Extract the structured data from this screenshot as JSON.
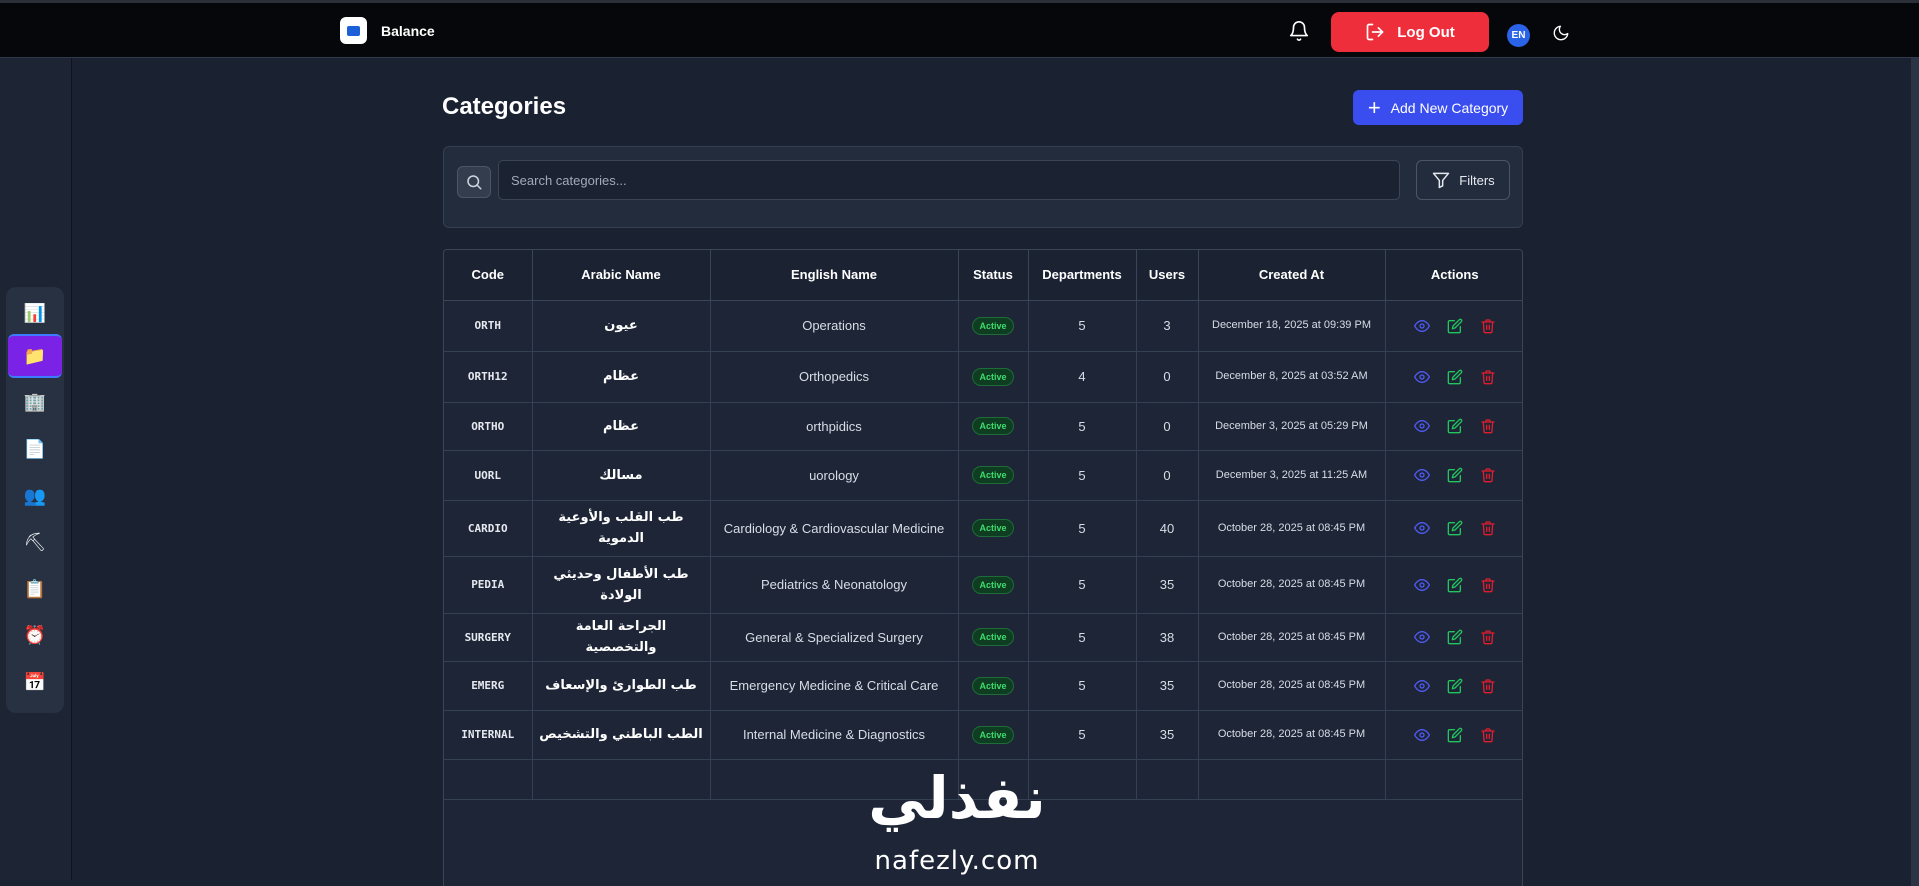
{
  "app": {
    "brand": "Balance",
    "logout_label": "Log Out",
    "language": "EN"
  },
  "sidebar": {
    "items": [
      {
        "icon": "bar-chart-icon",
        "glyph": "📊"
      },
      {
        "icon": "folder-icon",
        "glyph": "📁"
      },
      {
        "icon": "office-building-icon",
        "glyph": "🏢"
      },
      {
        "icon": "document-icon",
        "glyph": "📄"
      },
      {
        "icon": "users-icon",
        "glyph": "👥"
      },
      {
        "icon": "pickaxe-icon",
        "glyph": "⛏"
      },
      {
        "icon": "clipboard-icon",
        "glyph": "📋"
      },
      {
        "icon": "alarm-clock-icon",
        "glyph": "⏰"
      },
      {
        "icon": "calendar-icon",
        "glyph": "📅"
      }
    ]
  },
  "page": {
    "title": "Categories",
    "add_button": "Add New Category",
    "search_placeholder": "Search categories...",
    "filters_label": "Filters"
  },
  "table": {
    "columns": [
      "Code",
      "Arabic Name",
      "English Name",
      "Status",
      "Departments",
      "Users",
      "Created At",
      "Actions"
    ],
    "rows": [
      {
        "code": "ORTH",
        "arabic": "عيون",
        "english": "Operations",
        "status": "Active",
        "departments": "5",
        "users": "3",
        "created": "December 18, 2025 at 09:39 PM"
      },
      {
        "code": "ORTH12",
        "arabic": "عظام",
        "english": "Orthopedics",
        "status": "Active",
        "departments": "4",
        "users": "0",
        "created": "December 8, 2025 at 03:52 AM"
      },
      {
        "code": "ORTHO",
        "arabic": "عظام",
        "english": "orthpidics",
        "status": "Active",
        "departments": "5",
        "users": "0",
        "created": "December 3, 2025 at 05:29 PM"
      },
      {
        "code": "UORL",
        "arabic": "مسالك",
        "english": "uorology",
        "status": "Active",
        "departments": "5",
        "users": "0",
        "created": "December 3, 2025 at 11:25 AM"
      },
      {
        "code": "CARDIO",
        "arabic": "طب القلب والأوعية الدموية",
        "english": "Cardiology & Cardiovascular Medicine",
        "status": "Active",
        "departments": "5",
        "users": "40",
        "created": "October 28, 2025 at 08:45 PM"
      },
      {
        "code": "PEDIA",
        "arabic": "طب الأطفال وحديثي الولادة",
        "english": "Pediatrics & Neonatology",
        "status": "Active",
        "departments": "5",
        "users": "35",
        "created": "October 28, 2025 at 08:45 PM"
      },
      {
        "code": "SURGERY",
        "arabic": "الجراحة العامة والتخصصية",
        "english": "General & Specialized Surgery",
        "status": "Active",
        "departments": "5",
        "users": "38",
        "created": "October 28, 2025 at 08:45 PM"
      },
      {
        "code": "EMERG",
        "arabic": "طب الطوارئ والإسعاف",
        "english": "Emergency Medicine & Critical Care",
        "status": "Active",
        "departments": "5",
        "users": "35",
        "created": "October 28, 2025 at 08:45 PM"
      },
      {
        "code": "INTERNAL",
        "arabic": "الطب الباطني والتشخيص",
        "english": "Internal Medicine & Diagnostics",
        "status": "Active",
        "departments": "5",
        "users": "35",
        "created": "October 28, 2025 at 08:45 PM"
      }
    ]
  },
  "watermark": {
    "arabic": "نفذلي",
    "latin": "nafezly.com"
  },
  "colors": {
    "logout": "#ef2e3b",
    "primary": "#3a4ef0",
    "active_nav": "#7a22e6",
    "view": "#4f5bf5",
    "edit": "#22c55e",
    "delete": "#e11d2e",
    "status_active": "#3fdc6c"
  }
}
